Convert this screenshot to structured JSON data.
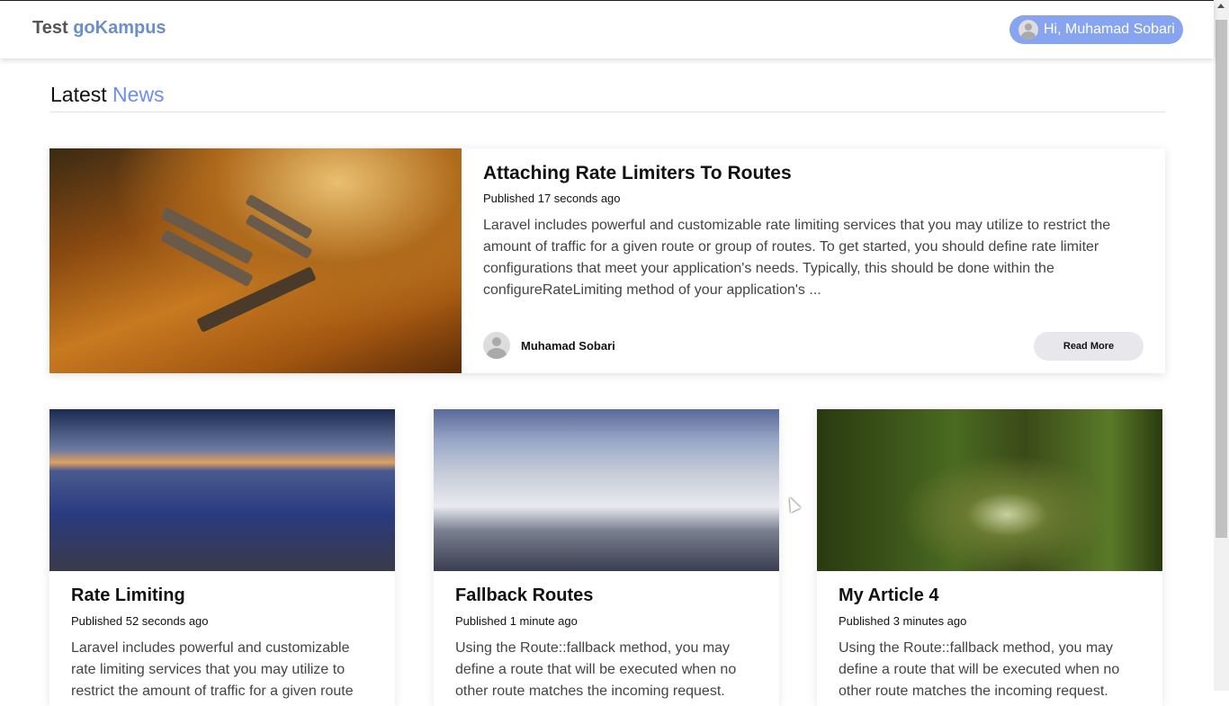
{
  "navbar": {
    "brand_prefix": "Test",
    "brand_name": "goKampus",
    "user_greeting": "Hi, Muhamad Sobari"
  },
  "section": {
    "title_prefix": "Latest",
    "title_highlight": "News"
  },
  "featured": {
    "title": "Attaching Rate Limiters To Routes",
    "published": "Published 17 seconds ago",
    "excerpt": "Laravel includes powerful and customizable rate limiting services that you may utilize to restrict the amount of traffic for a given route or group of routes. To get started, you should define rate limiter configurations that meet your application's needs. Typically, this should be done within the configureRateLimiting method of your application's ...",
    "author": "Muhamad Sobari",
    "read_more": "Read More"
  },
  "articles": [
    {
      "title": "Rate Limiting",
      "published": "Published 52 seconds ago",
      "excerpt": "Laravel includes powerful and customizable rate limiting services that you may utilize to restrict the amount of traffic for a given route"
    },
    {
      "title": "Fallback Routes",
      "published": "Published 1 minute ago",
      "excerpt": "Using the Route::fallback method, you may define a route that will be executed when no other route matches the incoming request."
    },
    {
      "title": "My Article 4",
      "published": "Published 3 minutes ago",
      "excerpt": "Using the Route::fallback method, you may define a route that will be executed when no other route matches the incoming request."
    }
  ],
  "colors": {
    "accent": "#86a4ef",
    "brand": "#6b8fc9",
    "news": "#6d8ef0"
  }
}
